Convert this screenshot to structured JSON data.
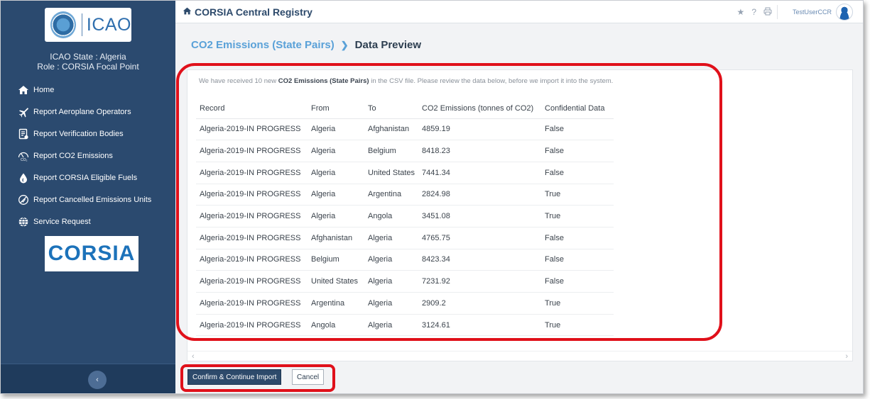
{
  "app": {
    "title": "CORSIA Central Registry"
  },
  "sidebar": {
    "logo_text": "ICAO",
    "state_line": "ICAO State : Algeria",
    "role_line": "Role : CORSIA Focal Point",
    "items": [
      {
        "label": "Home",
        "icon": "home-icon"
      },
      {
        "label": "Report Aeroplane Operators",
        "icon": "airplane-icon"
      },
      {
        "label": "Report Verification Bodies",
        "icon": "document-icon"
      },
      {
        "label": "Report CO2 Emissions",
        "icon": "co2-icon"
      },
      {
        "label": "Report CORSIA Eligible Fuels",
        "icon": "fuel-drop-icon"
      },
      {
        "label": "Report Cancelled Emissions Units",
        "icon": "cancel-circle-icon"
      },
      {
        "label": "Service Request",
        "icon": "globe-icon"
      }
    ],
    "corsia_logo_text": "CORSIA"
  },
  "header": {
    "user_name": "TestUserCCR"
  },
  "breadcrumb": {
    "parent": "CO2 Emissions (State Pairs)",
    "current": "Data Preview"
  },
  "info": {
    "prefix": "We have received 10 new ",
    "bold": "CO2 Emissions (State Pairs)",
    "suffix": " in the CSV file. Please review the data below, before we import it into the system."
  },
  "table": {
    "columns": [
      "Record",
      "From",
      "To",
      "CO2 Emissions (tonnes of CO2)",
      "Confidential Data"
    ],
    "rows": [
      [
        "Algeria-2019-IN PROGRESS",
        "Algeria",
        "Afghanistan",
        "4859.19",
        "False"
      ],
      [
        "Algeria-2019-IN PROGRESS",
        "Algeria",
        "Belgium",
        "8418.23",
        "False"
      ],
      [
        "Algeria-2019-IN PROGRESS",
        "Algeria",
        "United States",
        "7441.34",
        "False"
      ],
      [
        "Algeria-2019-IN PROGRESS",
        "Algeria",
        "Argentina",
        "2824.98",
        "True"
      ],
      [
        "Algeria-2019-IN PROGRESS",
        "Algeria",
        "Angola",
        "3451.08",
        "True"
      ],
      [
        "Algeria-2019-IN PROGRESS",
        "Afghanistan",
        "Algeria",
        "4765.75",
        "False"
      ],
      [
        "Algeria-2019-IN PROGRESS",
        "Belgium",
        "Algeria",
        "8423.34",
        "False"
      ],
      [
        "Algeria-2019-IN PROGRESS",
        "United States",
        "Algeria",
        "7231.92",
        "False"
      ],
      [
        "Algeria-2019-IN PROGRESS",
        "Argentina",
        "Algeria",
        "2909.2",
        "True"
      ],
      [
        "Algeria-2019-IN PROGRESS",
        "Angola",
        "Algeria",
        "3124.61",
        "True"
      ]
    ]
  },
  "actions": {
    "confirm_label": "Confirm & Continue Import",
    "cancel_label": "Cancel"
  },
  "colors": {
    "sidebar_bg": "#2b4a6f",
    "accent_link": "#5aa1d8",
    "primary_button": "#2d4a6b",
    "highlight": "#e0101a"
  }
}
